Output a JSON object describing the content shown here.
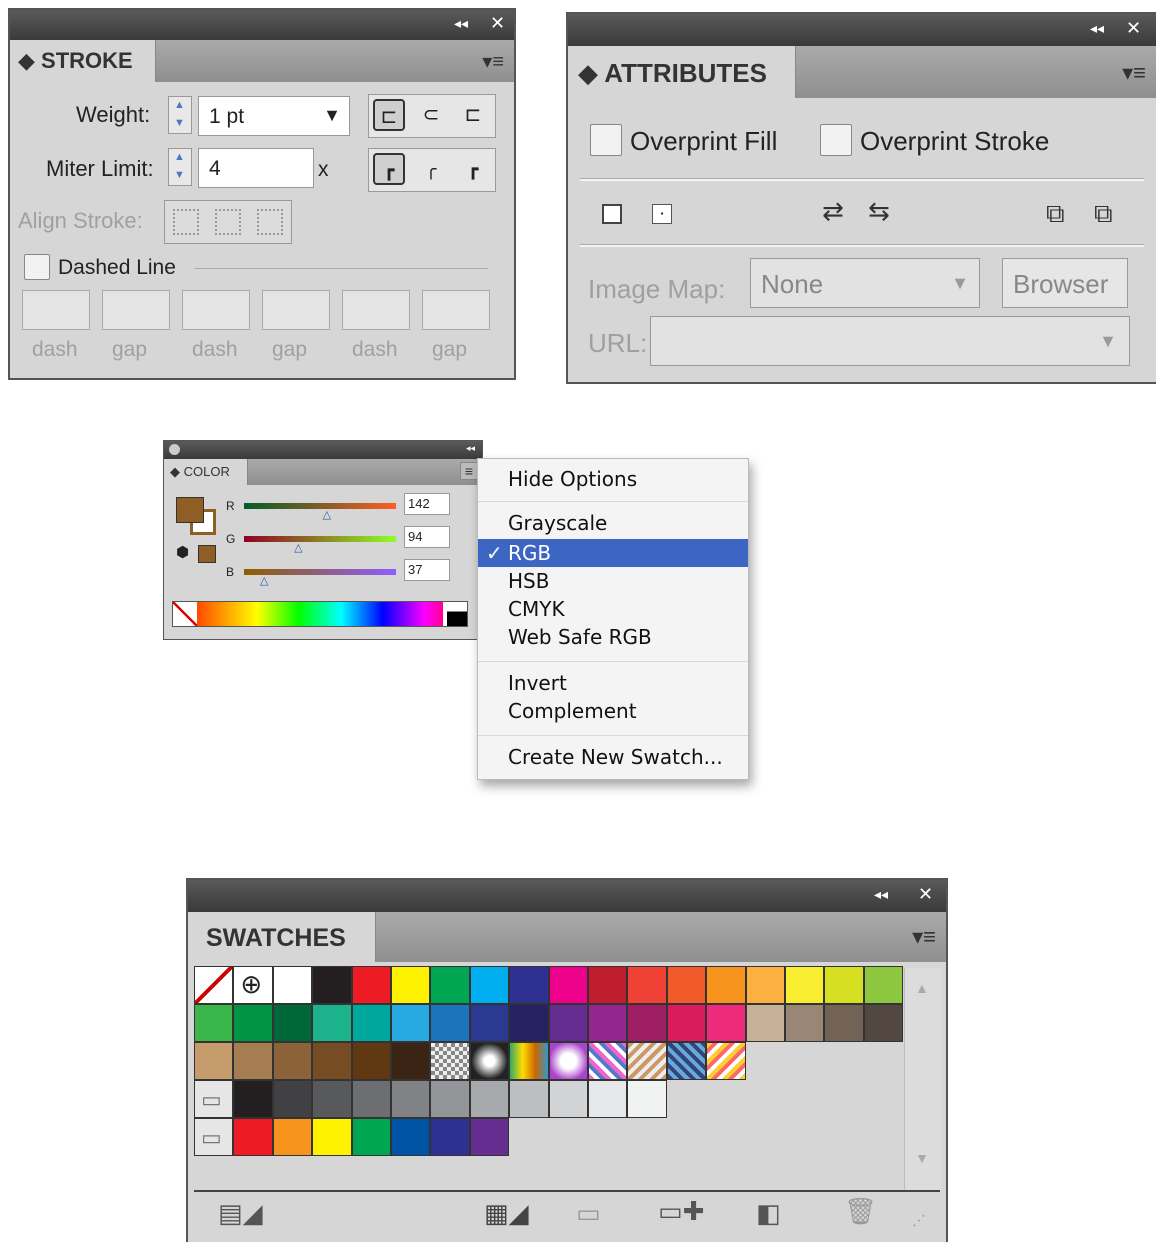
{
  "stroke": {
    "collapse_glyph": "◂◂",
    "close_glyph": "✕",
    "tab": "◆ STROKE",
    "menu_icon": "▾≡",
    "weight_label": "Weight:",
    "weight_value": "1 pt",
    "miter_label": "Miter Limit:",
    "miter_value": "4",
    "miter_unit": "x",
    "align_label": "Align Stroke:",
    "dashed_label": "Dashed Line",
    "dash_labels": [
      "dash",
      "gap",
      "dash",
      "gap",
      "dash",
      "gap"
    ]
  },
  "attributes": {
    "collapse_glyph": "◂◂",
    "close_glyph": "✕",
    "tab": "◆ ATTRIBUTES",
    "menu_icon": "▾≡",
    "overprint_fill": "Overprint Fill",
    "overprint_stroke": "Overprint Stroke",
    "image_map_label": "Image Map:",
    "image_map_value": "None",
    "browser_button": "Browser",
    "url_label": "URL:",
    "url_value": ""
  },
  "color": {
    "collapse_glyph": "◂◂",
    "tab": "◆ COLOR",
    "menu_icon": "≡",
    "channels": [
      {
        "label": "R",
        "value": "142",
        "fraction": 0.557
      },
      {
        "label": "G",
        "value": "94",
        "fraction": 0.369
      },
      {
        "label": "B",
        "value": "37",
        "fraction": 0.145
      }
    ],
    "fill_color": "#8e5e25"
  },
  "menu": {
    "hide_options": "Hide Options",
    "grayscale": "Grayscale",
    "rgb": "RGB",
    "checkmark": "✓",
    "hsb": "HSB",
    "cmyk": "CMYK",
    "web_safe_rgb": "Web Safe RGB",
    "invert": "Invert",
    "complement": "Complement",
    "create_new_swatch": "Create New Swatch..."
  },
  "swatches": {
    "collapse_glyph": "◂◂",
    "close_glyph": "✕",
    "tab": "SWATCHES",
    "menu_icon": "▾≡",
    "row1": [
      "none",
      "registration",
      "#ffffff",
      "#231f20",
      "#ed1c24",
      "#fff200",
      "#00a651",
      "#00aeef",
      "#2e3192",
      "#ec008c",
      "#be1e2d",
      "#ef4136",
      "#f15a29",
      "#f7941d",
      "#fbb040",
      "#f9ed32",
      "#d7df23",
      "#8dc63f"
    ],
    "row2": [
      "#39b54a",
      "#009444",
      "#006838",
      "#1bb28c",
      "#00a79d",
      "#27aae1",
      "#1c75bc",
      "#2b3990",
      "#262262",
      "#662d91",
      "#92278f",
      "#9e1f63",
      "#da1c5c",
      "#ee2a7b",
      "#c7b299",
      "#998675",
      "#736357",
      "#534741"
    ],
    "row3": [
      "#c69c6d",
      "#a67c52",
      "#8c6239",
      "#754c24",
      "#603913",
      "#3c2415",
      "pattern",
      "pattern",
      "pattern",
      "pattern",
      "pattern",
      "pattern",
      "pattern",
      "pattern"
    ],
    "row4": [
      "#231f20",
      "#414042",
      "#58595b",
      "#6d6e71",
      "#808285",
      "#939598",
      "#a7a9ac",
      "#bcbec0",
      "#d1d3d4",
      "#e6e7e8",
      "#f1f2f2"
    ],
    "row5": [
      "#ed1c24",
      "#f7941d",
      "#fff200",
      "#00a651",
      "#0054a6",
      "#2e3192",
      "#662d91"
    ]
  }
}
